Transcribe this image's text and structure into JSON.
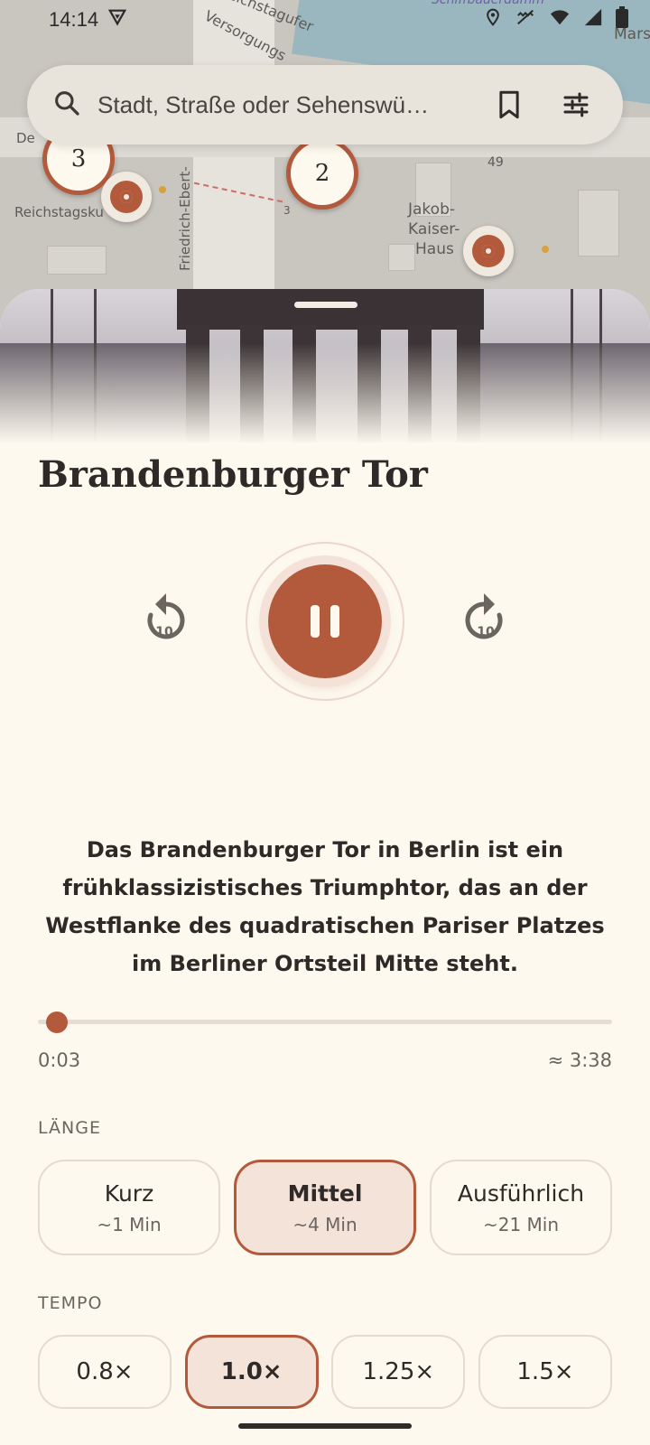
{
  "status_bar": {
    "time": "14:14"
  },
  "map": {
    "labels": {
      "street_1": "Reichstagufer",
      "street_2": "Versorgungs",
      "street_3": "Friedrich-Ebert-",
      "place_1": "Reichstagsku",
      "place_2": "Jakob-",
      "place_3": "Kaiser-",
      "place_4": "Haus",
      "street_4": "Schiffbauerdamm",
      "street_5": "Mars",
      "num_1": "49",
      "num_2": "3",
      "place_5": "De"
    },
    "clusters": [
      "3",
      "2"
    ]
  },
  "search": {
    "placeholder": "Stadt, Straße oder Sehenswü…"
  },
  "sheet": {
    "title": "Brandenburger Tor",
    "skip_back": "10",
    "skip_forward": "10",
    "description": "Das Brandenburger Tor in Berlin ist ein frühklassizistisches Triumphtor, das an der Westflanke des quadratischen Pariser Platzes im Berliner Ortsteil Mitte steht.",
    "progress": {
      "current": "0:03",
      "total": "≈ 3:38",
      "fraction": 0.014
    },
    "length": {
      "label": "LÄNGE",
      "options": [
        {
          "label": "Kurz",
          "sub": "~1 Min"
        },
        {
          "label": "Mittel",
          "sub": "~4 Min"
        },
        {
          "label": "Ausführlich",
          "sub": "~21 Min"
        }
      ],
      "selected": 1
    },
    "tempo": {
      "label": "TEMPO",
      "options": [
        "0.8×",
        "1.0×",
        "1.25×",
        "1.5×"
      ],
      "selected": 1
    }
  },
  "colors": {
    "accent": "#b45a3c",
    "background": "#fdf9ef",
    "chip_selected": "#f4e3d9"
  }
}
